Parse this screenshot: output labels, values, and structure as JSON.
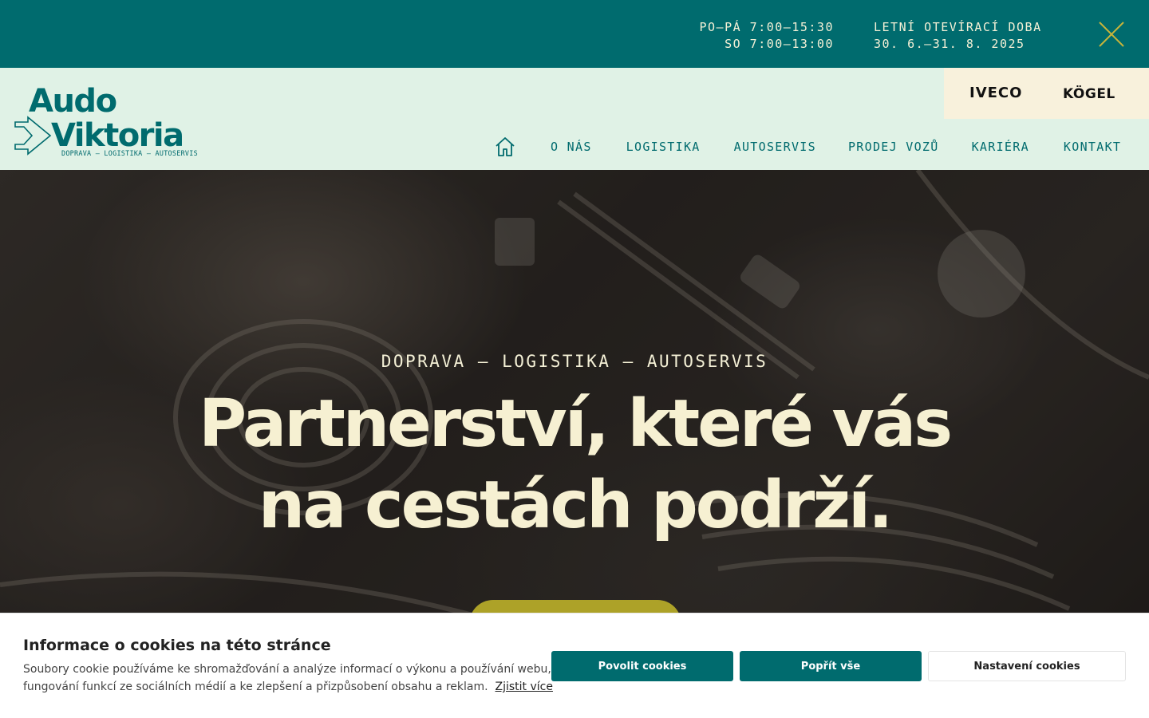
{
  "topbar": {
    "hours_weekday": "PO—PÁ 7:00—15:30",
    "hours_saturday": "SO 7:00—13:00",
    "summer_title": "LETNÍ OTEVÍRACÍ DOBA",
    "summer_dates": "30. 6.—31. 8. 2025",
    "close_icon": "close-icon"
  },
  "logo": {
    "line1": "Audo",
    "line2": "Viktoria",
    "tagline": "DOPRAVA — LOGISTIKA — AUTOSERVIS"
  },
  "brands": [
    "IVECO",
    "KÖGEL"
  ],
  "nav": {
    "home_icon": "home-icon",
    "items": [
      "O NÁS",
      "LOGISTIKA",
      "AUTOSERVIS",
      "PRODEJ VOZŮ",
      "KARIÉRA",
      "KONTAKT"
    ]
  },
  "hero": {
    "tagline": "DOPRAVA — LOGISTIKA — AUTOSERVIS",
    "title_line1": "Partnerství, které vás",
    "title_line2": "na cestách podrží."
  },
  "cookie": {
    "title": "Informace o cookies na této stránce",
    "text": "Soubory cookie používáme ke shromažďování a analýze informací o výkonu a používání webu, fungování funkcí ze sociálních médií a ke zlepšení a přizpůsobení obsahu a reklam.",
    "link": "Zjistit více",
    "allow": "Povolit cookies",
    "reject": "Popřít vše",
    "settings": "Nastavení cookies"
  },
  "colors": {
    "teal": "#006b6e",
    "mint": "#e0f2e6",
    "cream": "#f6f0d2",
    "olive": "#ada228",
    "brand_bg": "#f8f1dc"
  }
}
